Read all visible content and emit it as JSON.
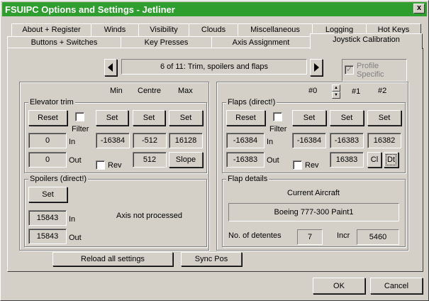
{
  "window": {
    "title": "FSUIPC Options and Settings - Jetliner",
    "close_glyph": "x"
  },
  "tabs_row1": [
    "About + Register",
    "Winds",
    "Visibility",
    "Clouds",
    "Miscellaneous",
    "Logging",
    "Hot Keys"
  ],
  "tabs_row2": [
    "Buttons + Switches",
    "Key Presses",
    "Axis Assignment",
    "Joystick Calibration"
  ],
  "nav": {
    "page": "6 of 11: Trim, spoilers and flaps",
    "profile": "Profile Specific"
  },
  "left": {
    "headers": {
      "min": "Min",
      "centre": "Centre",
      "max": "Max"
    },
    "elevator": {
      "title": "Elevator trim",
      "reset": "Reset",
      "filter": "Filter",
      "set_min": "Set",
      "set_centre": "Set",
      "set_max": "Set",
      "in_val": "0",
      "in_lbl": "In",
      "out_val": "0",
      "out_lbl": "Out",
      "min": "-16384",
      "centre": "-512",
      "max": "16128",
      "rev": "Rev",
      "centre2": "512",
      "slope": "Slope"
    },
    "spoilers": {
      "title": "Spoilers (direct!)",
      "set": "Set",
      "in_val": "15843",
      "in_lbl": "In",
      "out_val": "15843",
      "out_lbl": "Out",
      "status": "Axis not processed"
    }
  },
  "right": {
    "headers": {
      "h0": "#0",
      "h1": "#1",
      "h2": "#2"
    },
    "flaps": {
      "title": "Flaps (direct!)",
      "reset": "Reset",
      "filter": "Filter",
      "set1": "Set",
      "set2": "Set",
      "set3": "Set",
      "in_val": "-16384",
      "in_lbl": "In",
      "out_val": "-16383",
      "out_lbl": "Out",
      "v1": "-16384",
      "v2": "-16383",
      "v3": "16382",
      "rev": "Rev",
      "v4": "16383",
      "cl": "Cl",
      "dt": "Dt"
    },
    "details": {
      "title": "Flap details",
      "aircraft_lbl": "Current Aircraft",
      "aircraft": "Boeing 777-300 Paint1",
      "detentes_lbl": "No. of detentes",
      "detentes": "7",
      "incr_lbl": "Incr",
      "incr": "5460"
    }
  },
  "bottom": {
    "reload": "Reload all settings",
    "sync": "Sync Pos",
    "ok": "OK",
    "cancel": "Cancel"
  }
}
